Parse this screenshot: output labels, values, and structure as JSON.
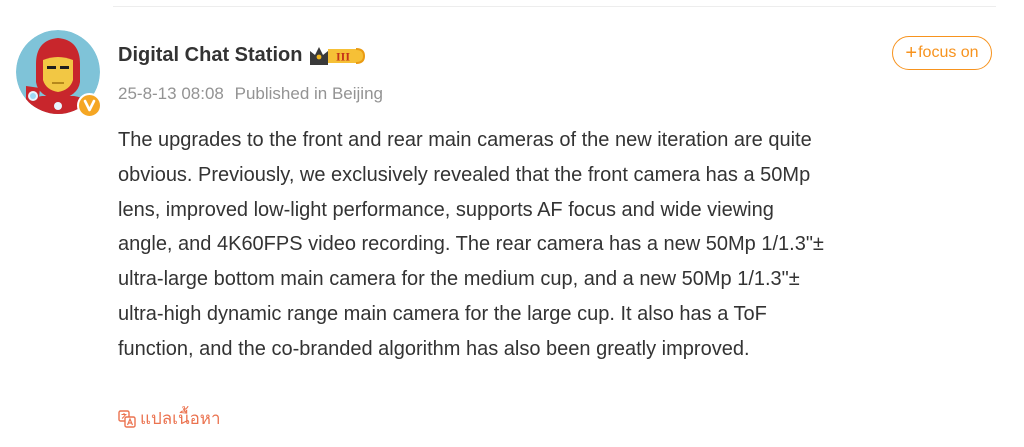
{
  "post": {
    "author": {
      "name": "Digital Chat Station",
      "level_badge": "III"
    },
    "meta": {
      "timestamp": "25-8-13 08:08",
      "location": "Published in Beijing"
    },
    "follow_button": {
      "plus": "+",
      "label": "focus on"
    },
    "content_lines": [
      "The upgrades to the front and rear main cameras of the new iteration are quite",
      "obvious. Previously, we exclusively revealed that the front camera has a 50Mp",
      "lens, improved low-light performance, supports AF focus and wide viewing",
      "angle, and 4K60FPS video recording. The rear camera has a new 50Mp 1/1.3\"±",
      "ultra-large bottom main camera for the medium cup, and a new 50Mp 1/1.3\"±",
      "ultra-high dynamic range main camera for the large cup. It also has a ToF",
      "function, and the co-branded algorithm has also been greatly improved."
    ],
    "translate_label": "แปลเนื้อหา"
  },
  "colors": {
    "accent_orange": "#f7931e",
    "translate_orange": "#eb7350",
    "text_main": "#333333",
    "text_meta": "#939393",
    "verified_badge": "#f5a623"
  },
  "icons": {
    "avatar": "iron-man-cartoon-avatar",
    "verified": "verified-v-icon",
    "level": "crown-level-badge-icon",
    "translate": "translate-icon"
  }
}
